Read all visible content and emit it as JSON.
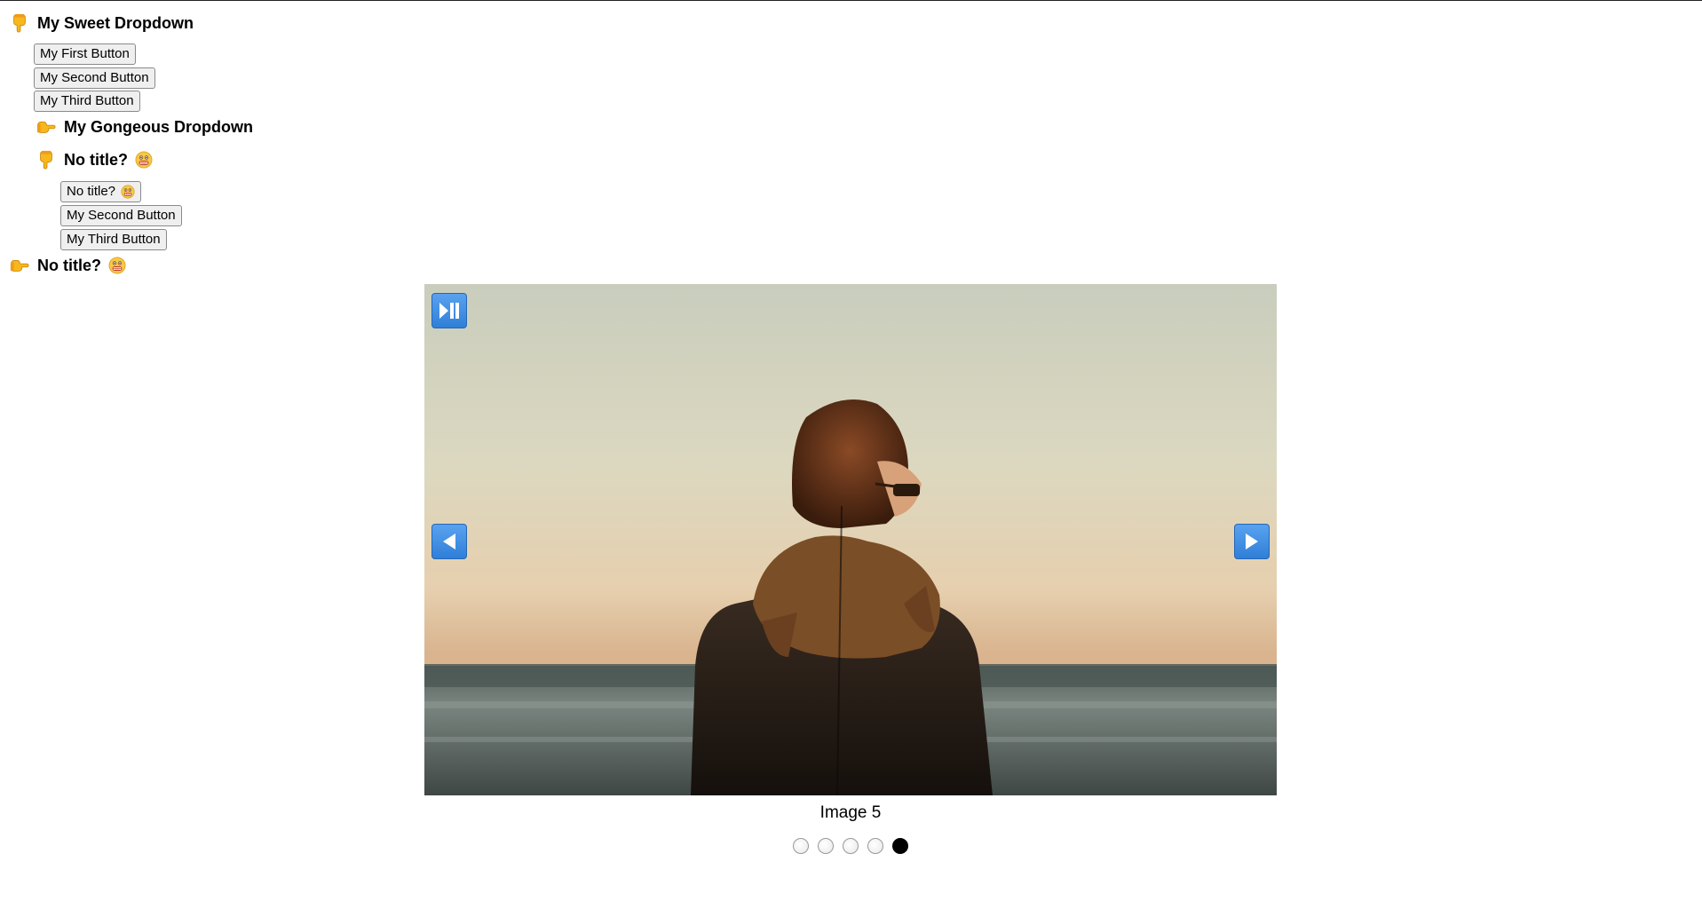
{
  "dropdowns": {
    "sweet": {
      "title": "My Sweet Dropdown",
      "buttons": [
        "My First Button",
        "My Second Button",
        "My Third Button"
      ]
    },
    "gorgeous": {
      "title": "My Gongeous Dropdown"
    },
    "nested_no_title": {
      "title": "No title?",
      "buttons": [
        "No title?",
        "My Second Button",
        "My Third Button"
      ]
    },
    "bottom_no_title": {
      "title": "No title?"
    }
  },
  "icons": {
    "expanded": "pointing-down-hand-icon",
    "collapsed": "pointing-right-hand-icon",
    "face": "grimacing-face-icon"
  },
  "slider": {
    "caption": "Image 5",
    "total": 5,
    "current": 5,
    "controls": {
      "playpause": "play-pause-icon",
      "prev": "left-arrow-icon",
      "next": "right-arrow-icon"
    }
  },
  "colors": {
    "control_blue": "#3a8be6",
    "hand_yellow": "#f5b21c"
  }
}
